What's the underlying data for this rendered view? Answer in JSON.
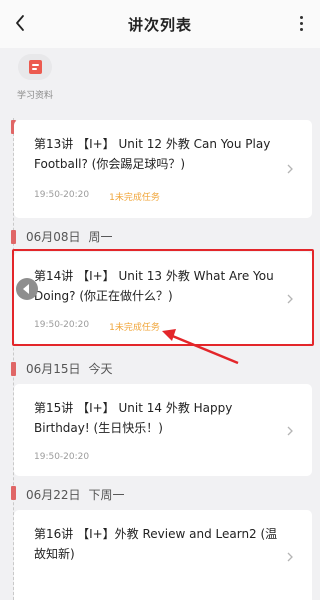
{
  "header": {
    "title": "讲次列表"
  },
  "materials": {
    "label": "学习资料"
  },
  "dates": [
    {
      "date": "06月08日",
      "weekday": "周一"
    },
    {
      "date": "06月15日",
      "weekday": "今天"
    },
    {
      "date": "06月22日",
      "weekday": "下周一"
    }
  ],
  "lessons": [
    {
      "title": "第13讲 【Ⅰ+】 Unit 12 外教 Can You Play Football? (你会踢足球吗？)",
      "time": "19:50-20:20",
      "status": "1未完成任务"
    },
    {
      "title": "第14讲 【Ⅰ+】 Unit 13 外教 What Are You Doing? (你正在做什么？)",
      "time": "19:50-20:20",
      "status": "1未完成任务"
    },
    {
      "title": "第15讲 【Ⅰ+】 Unit 14 外教 Happy Birthday! (生日快乐！)",
      "time": "19:50-20:20",
      "status": ""
    },
    {
      "title": "第16讲 【Ⅰ+】外教 Review and Learn2 (温故知新)",
      "time": "",
      "status": ""
    }
  ],
  "colors": {
    "accent_red": "#e3262a",
    "status_orange": "#f0a63b",
    "doc_icon": "#ec5a4f"
  }
}
